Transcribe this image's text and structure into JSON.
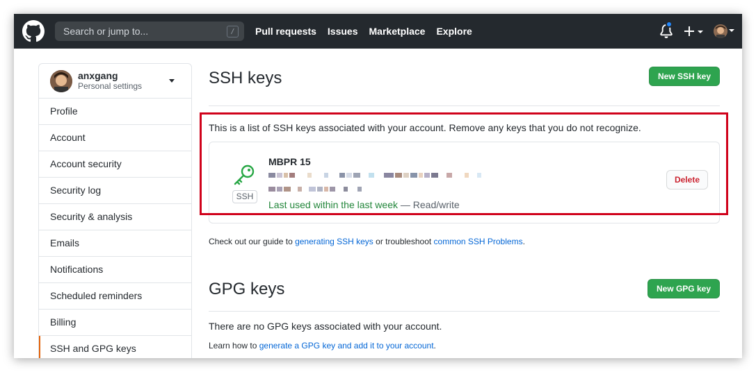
{
  "header": {
    "search": {
      "placeholder": "Search or jump to...",
      "shortcut": "/"
    },
    "nav": [
      "Pull requests",
      "Issues",
      "Marketplace",
      "Explore"
    ],
    "icons": [
      "github-logo",
      "bell-icon",
      "plus-icon",
      "avatar"
    ],
    "notification_color": "#2188ff"
  },
  "sidebar": {
    "user": {
      "name": "anxgang",
      "subtitle": "Personal settings"
    },
    "items": [
      {
        "label": "Profile"
      },
      {
        "label": "Account"
      },
      {
        "label": "Account security"
      },
      {
        "label": "Security log"
      },
      {
        "label": "Security & analysis"
      },
      {
        "label": "Emails"
      },
      {
        "label": "Notifications"
      },
      {
        "label": "Scheduled reminders"
      },
      {
        "label": "Billing"
      },
      {
        "label": "SSH and GPG keys"
      }
    ],
    "selected_accent": "#e36209"
  },
  "ssh": {
    "title": "SSH keys",
    "new_button": "New SSH key",
    "intro": "This is a list of SSH keys associated with your account. Remove any keys that you do not recognize.",
    "key": {
      "name": "MBPR 15",
      "type_label": "SSH",
      "last_used": "Last used within the last week",
      "access": " — Read/write",
      "delete_button": "Delete"
    },
    "guide": {
      "prefix": "Check out our guide to ",
      "link1": "generating SSH keys",
      "middle": " or troubleshoot ",
      "link2": "common SSH Problems",
      "suffix": "."
    }
  },
  "gpg": {
    "title": "GPG keys",
    "new_button": "New GPG key",
    "empty": "There are no GPG keys associated with your account.",
    "learn": {
      "prefix": "Learn how to ",
      "link": "generate a GPG key and add it to your account",
      "suffix": "."
    }
  },
  "colors": {
    "header_bg": "#24292e",
    "primary_button": "#2ea44f",
    "link": "#0366d6",
    "success_text": "#22863a",
    "danger_text": "#cb2431",
    "highlight_frame": "#d0021b"
  }
}
